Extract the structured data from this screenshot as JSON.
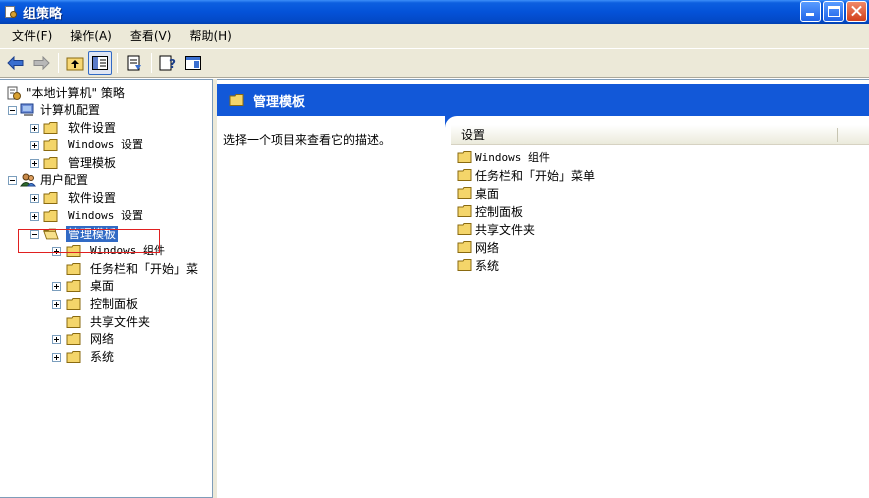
{
  "window": {
    "title": "组策略"
  },
  "menu": [
    {
      "label": "文件(F)"
    },
    {
      "label": "操作(A)"
    },
    {
      "label": "查看(V)"
    },
    {
      "label": "帮助(H)"
    }
  ],
  "toolbar": {
    "buttons": [
      {
        "icon": "back-arrow-icon"
      },
      {
        "icon": "forward-arrow-icon"
      },
      {
        "icon": "up-folder-icon"
      },
      {
        "icon": "show-hide-tree-icon",
        "pressed": true
      },
      {
        "icon": "export-list-icon"
      },
      {
        "icon": "help-icon"
      },
      {
        "icon": "properties-icon"
      }
    ]
  },
  "tree": {
    "root": "\"本地计算机\" 策略",
    "computer_config": "计算机配置",
    "computer_children": [
      "软件设置",
      "Windows 设置",
      "管理模板"
    ],
    "user_config": "用户配置",
    "user_children": [
      "软件设置",
      "Windows 设置",
      "管理模板"
    ],
    "admin_templates_children": [
      "Windows 组件",
      "任务栏和「开始」菜",
      "桌面",
      "控制面板",
      "共享文件夹",
      "网络",
      "系统"
    ]
  },
  "right": {
    "header_title": "管理模板",
    "description": "选择一个项目来查看它的描述。",
    "column_header": "设置",
    "items": [
      "Windows 组件",
      "任务栏和「开始」菜单",
      "桌面",
      "控制面板",
      "共享文件夹",
      "网络",
      "系统"
    ]
  }
}
